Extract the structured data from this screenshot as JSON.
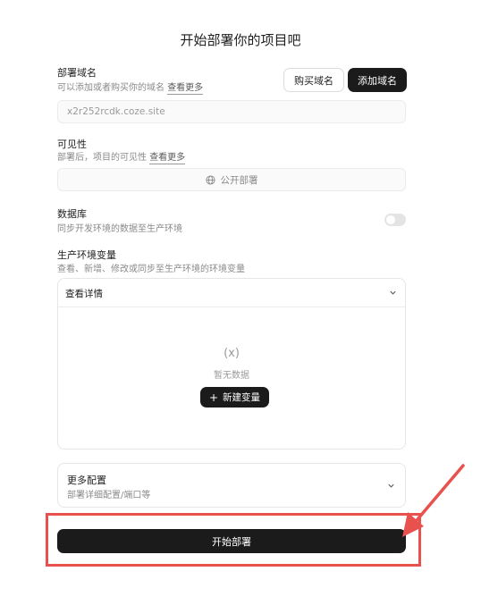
{
  "page": {
    "title": "开始部署你的项目吧"
  },
  "domain": {
    "label": "部署域名",
    "desc": "可以添加或者购买你的域名",
    "learn_more": "查看更多",
    "buy_button": "购买域名",
    "add_button": "添加域名",
    "current_value": "x2r252rcdk.coze.site"
  },
  "visibility": {
    "label": "可见性",
    "desc": "部署后，项目的可见性",
    "learn_more": "查看更多",
    "option": "公开部署"
  },
  "database": {
    "label": "数据库",
    "desc": "同步开发环境的数据至生产环境",
    "enabled": false
  },
  "env_vars": {
    "label": "生产环境变量",
    "desc": "查看、新增、修改或同步至生产环境的环境变量",
    "details_toggle": "查看详情",
    "empty_icon": "(x)",
    "empty_text": "暂无数据",
    "new_button": "新建变量"
  },
  "more_config": {
    "title": "更多配置",
    "desc": "部署详细配置/端口等"
  },
  "deploy": {
    "button": "开始部署"
  },
  "colors": {
    "annotation": "#e8514e",
    "primary": "#1b1b1b"
  }
}
